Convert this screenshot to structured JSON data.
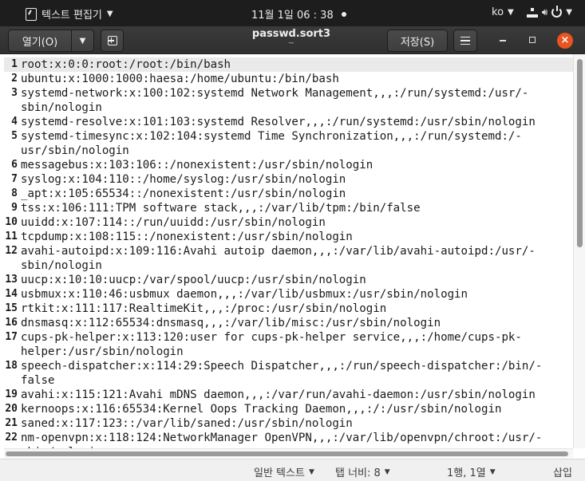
{
  "top_panel": {
    "app_name": "텍스트 편집기",
    "clock": "11월 1일  06 : 38",
    "input_lang": "ko"
  },
  "header": {
    "open_label": "열기(O)",
    "title": "passwd.sort3",
    "subtitle": "~",
    "save_label": "저장(S)"
  },
  "editor": {
    "lines": [
      {
        "n": "1",
        "t": "root:x:0:0:root:/root:/bin/bash"
      },
      {
        "n": "2",
        "t": "ubuntu:x:1000:1000:haesa:/home/ubuntu:/bin/bash"
      },
      {
        "n": "3",
        "t": "systemd-network:x:100:102:systemd Network Management,,,:/run/systemd:/usr/-"
      },
      {
        "n": "",
        "t": "sbin/nologin"
      },
      {
        "n": "4",
        "t": "systemd-resolve:x:101:103:systemd Resolver,,,:/run/systemd:/usr/sbin/nologin"
      },
      {
        "n": "5",
        "t": "systemd-timesync:x:102:104:systemd Time Synchronization,,,:/run/systemd:/-"
      },
      {
        "n": "",
        "t": "usr/sbin/nologin"
      },
      {
        "n": "6",
        "t": "messagebus:x:103:106::/nonexistent:/usr/sbin/nologin"
      },
      {
        "n": "7",
        "t": "syslog:x:104:110::/home/syslog:/usr/sbin/nologin"
      },
      {
        "n": "8",
        "t": "_apt:x:105:65534::/nonexistent:/usr/sbin/nologin"
      },
      {
        "n": "9",
        "t": "tss:x:106:111:TPM software stack,,,:/var/lib/tpm:/bin/false"
      },
      {
        "n": "10",
        "t": "uuidd:x:107:114::/run/uuidd:/usr/sbin/nologin"
      },
      {
        "n": "11",
        "t": "tcpdump:x:108:115::/nonexistent:/usr/sbin/nologin"
      },
      {
        "n": "12",
        "t": "avahi-autoipd:x:109:116:Avahi autoip daemon,,,:/var/lib/avahi-autoipd:/usr/-"
      },
      {
        "n": "",
        "t": "sbin/nologin"
      },
      {
        "n": "13",
        "t": "uucp:x:10:10:uucp:/var/spool/uucp:/usr/sbin/nologin"
      },
      {
        "n": "14",
        "t": "usbmux:x:110:46:usbmux daemon,,,:/var/lib/usbmux:/usr/sbin/nologin"
      },
      {
        "n": "15",
        "t": "rtkit:x:111:117:RealtimeKit,,,:/proc:/usr/sbin/nologin"
      },
      {
        "n": "16",
        "t": "dnsmasq:x:112:65534:dnsmasq,,,:/var/lib/misc:/usr/sbin/nologin"
      },
      {
        "n": "17",
        "t": "cups-pk-helper:x:113:120:user for cups-pk-helper service,,,:/home/cups-pk-"
      },
      {
        "n": "",
        "t": "helper:/usr/sbin/nologin"
      },
      {
        "n": "18",
        "t": "speech-dispatcher:x:114:29:Speech Dispatcher,,,:/run/speech-dispatcher:/bin/-"
      },
      {
        "n": "",
        "t": "false"
      },
      {
        "n": "19",
        "t": "avahi:x:115:121:Avahi mDNS daemon,,,:/var/run/avahi-daemon:/usr/sbin/nologin"
      },
      {
        "n": "20",
        "t": "kernoops:x:116:65534:Kernel Oops Tracking Daemon,,,:/:/usr/sbin/nologin"
      },
      {
        "n": "21",
        "t": "saned:x:117:123::/var/lib/saned:/usr/sbin/nologin"
      },
      {
        "n": "22",
        "t": "nm-openvpn:x:118:124:NetworkManager OpenVPN,,,:/var/lib/openvpn/chroot:/usr/-"
      },
      {
        "n": "",
        "t": "sbin/nologin"
      }
    ]
  },
  "statusbar": {
    "language": "일반 텍스트",
    "tab_width": "탭 너비: 8",
    "position": "1행, 1열",
    "mode": "삽입"
  }
}
